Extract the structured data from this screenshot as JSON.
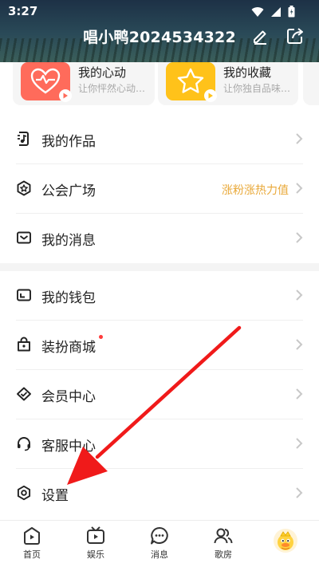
{
  "status_bar": {
    "time": "3:27"
  },
  "header": {
    "username": "唱小鸭2024534322"
  },
  "cards": [
    {
      "title": "我的心动",
      "subtitle": "让你怦然心动…",
      "color": "#ff6b5b"
    },
    {
      "title": "我的收藏",
      "subtitle": "让你独自品味…",
      "color": "#ffc21a"
    }
  ],
  "menu": [
    {
      "label": "我的作品",
      "icon": "music-doc-icon"
    },
    {
      "label": "公会广场",
      "icon": "guild-hexagon-icon",
      "extra": "涨粉涨热力值"
    },
    {
      "label": "我的消息",
      "icon": "mail-icon"
    },
    {
      "label": "我的钱包",
      "icon": "wallet-icon"
    },
    {
      "label": "装扮商城",
      "icon": "shop-bag-icon",
      "has_dot": true
    },
    {
      "label": "会员中心",
      "icon": "vip-diamond-icon"
    },
    {
      "label": "客服中心",
      "icon": "headset-icon"
    },
    {
      "label": "设置",
      "icon": "settings-gear-icon"
    }
  ],
  "bottom_nav": [
    {
      "label": "首页",
      "icon": "home-play-icon"
    },
    {
      "label": "娱乐",
      "icon": "tv-icon"
    },
    {
      "label": "消息",
      "icon": "chat-bubble-icon"
    },
    {
      "label": "歌房",
      "icon": "group-people-icon"
    },
    {
      "label": "",
      "icon": "duck-avatar-icon"
    }
  ],
  "colors": {
    "accent_orange": "#e9a93a",
    "annotation_red": "#f01a1a",
    "header_dark": "#1d3146"
  }
}
